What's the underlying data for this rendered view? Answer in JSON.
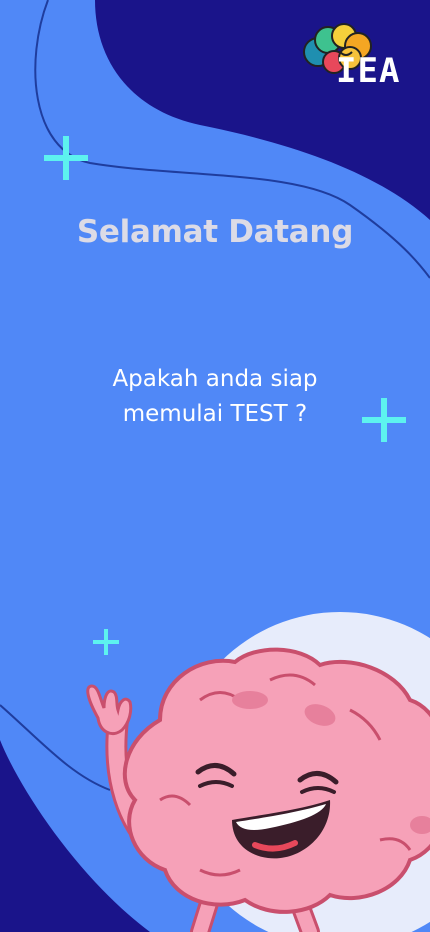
{
  "brand": {
    "logo_text": "IEA"
  },
  "welcome": {
    "title": "Selamat Datang",
    "question_line1": "Apakah anda siap",
    "question_line2": "memulai TEST ?"
  },
  "colors": {
    "dark_background": "#1a148a",
    "blue_wave": "#5088f7",
    "plus_accent": "#5df2ef",
    "brain_pink": "#f6a1b8",
    "bubble": "#e7ecfb"
  },
  "icons": {
    "logo": "colorful-brain-logo",
    "decorations": "plus-sparkle",
    "mascot": "waving-laughing-brain"
  }
}
